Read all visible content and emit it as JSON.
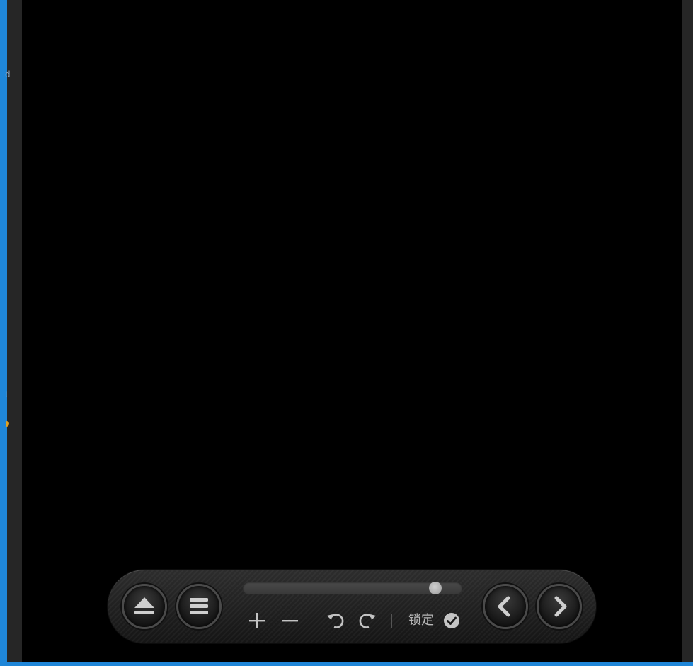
{
  "viewer": {
    "edge_glyph_top": "d",
    "edge_glyph_mid": "t"
  },
  "control_bar": {
    "eject_icon": "eject-icon",
    "menu_icon": "menu-icon",
    "progress_fraction": 0.9,
    "zoom_in_icon": "plus-icon",
    "zoom_out_icon": "minus-icon",
    "rotate_left_icon": "rotate-ccw-icon",
    "rotate_right_icon": "rotate-cw-icon",
    "lock_label": "锁定",
    "lock_icon": "check-circle-icon",
    "prev_icon": "chevron-left-icon",
    "next_icon": "chevron-right-icon"
  },
  "colors": {
    "frame_accent": "#1f86d8",
    "background": "#000000",
    "bar_text": "#b8b8b8"
  }
}
